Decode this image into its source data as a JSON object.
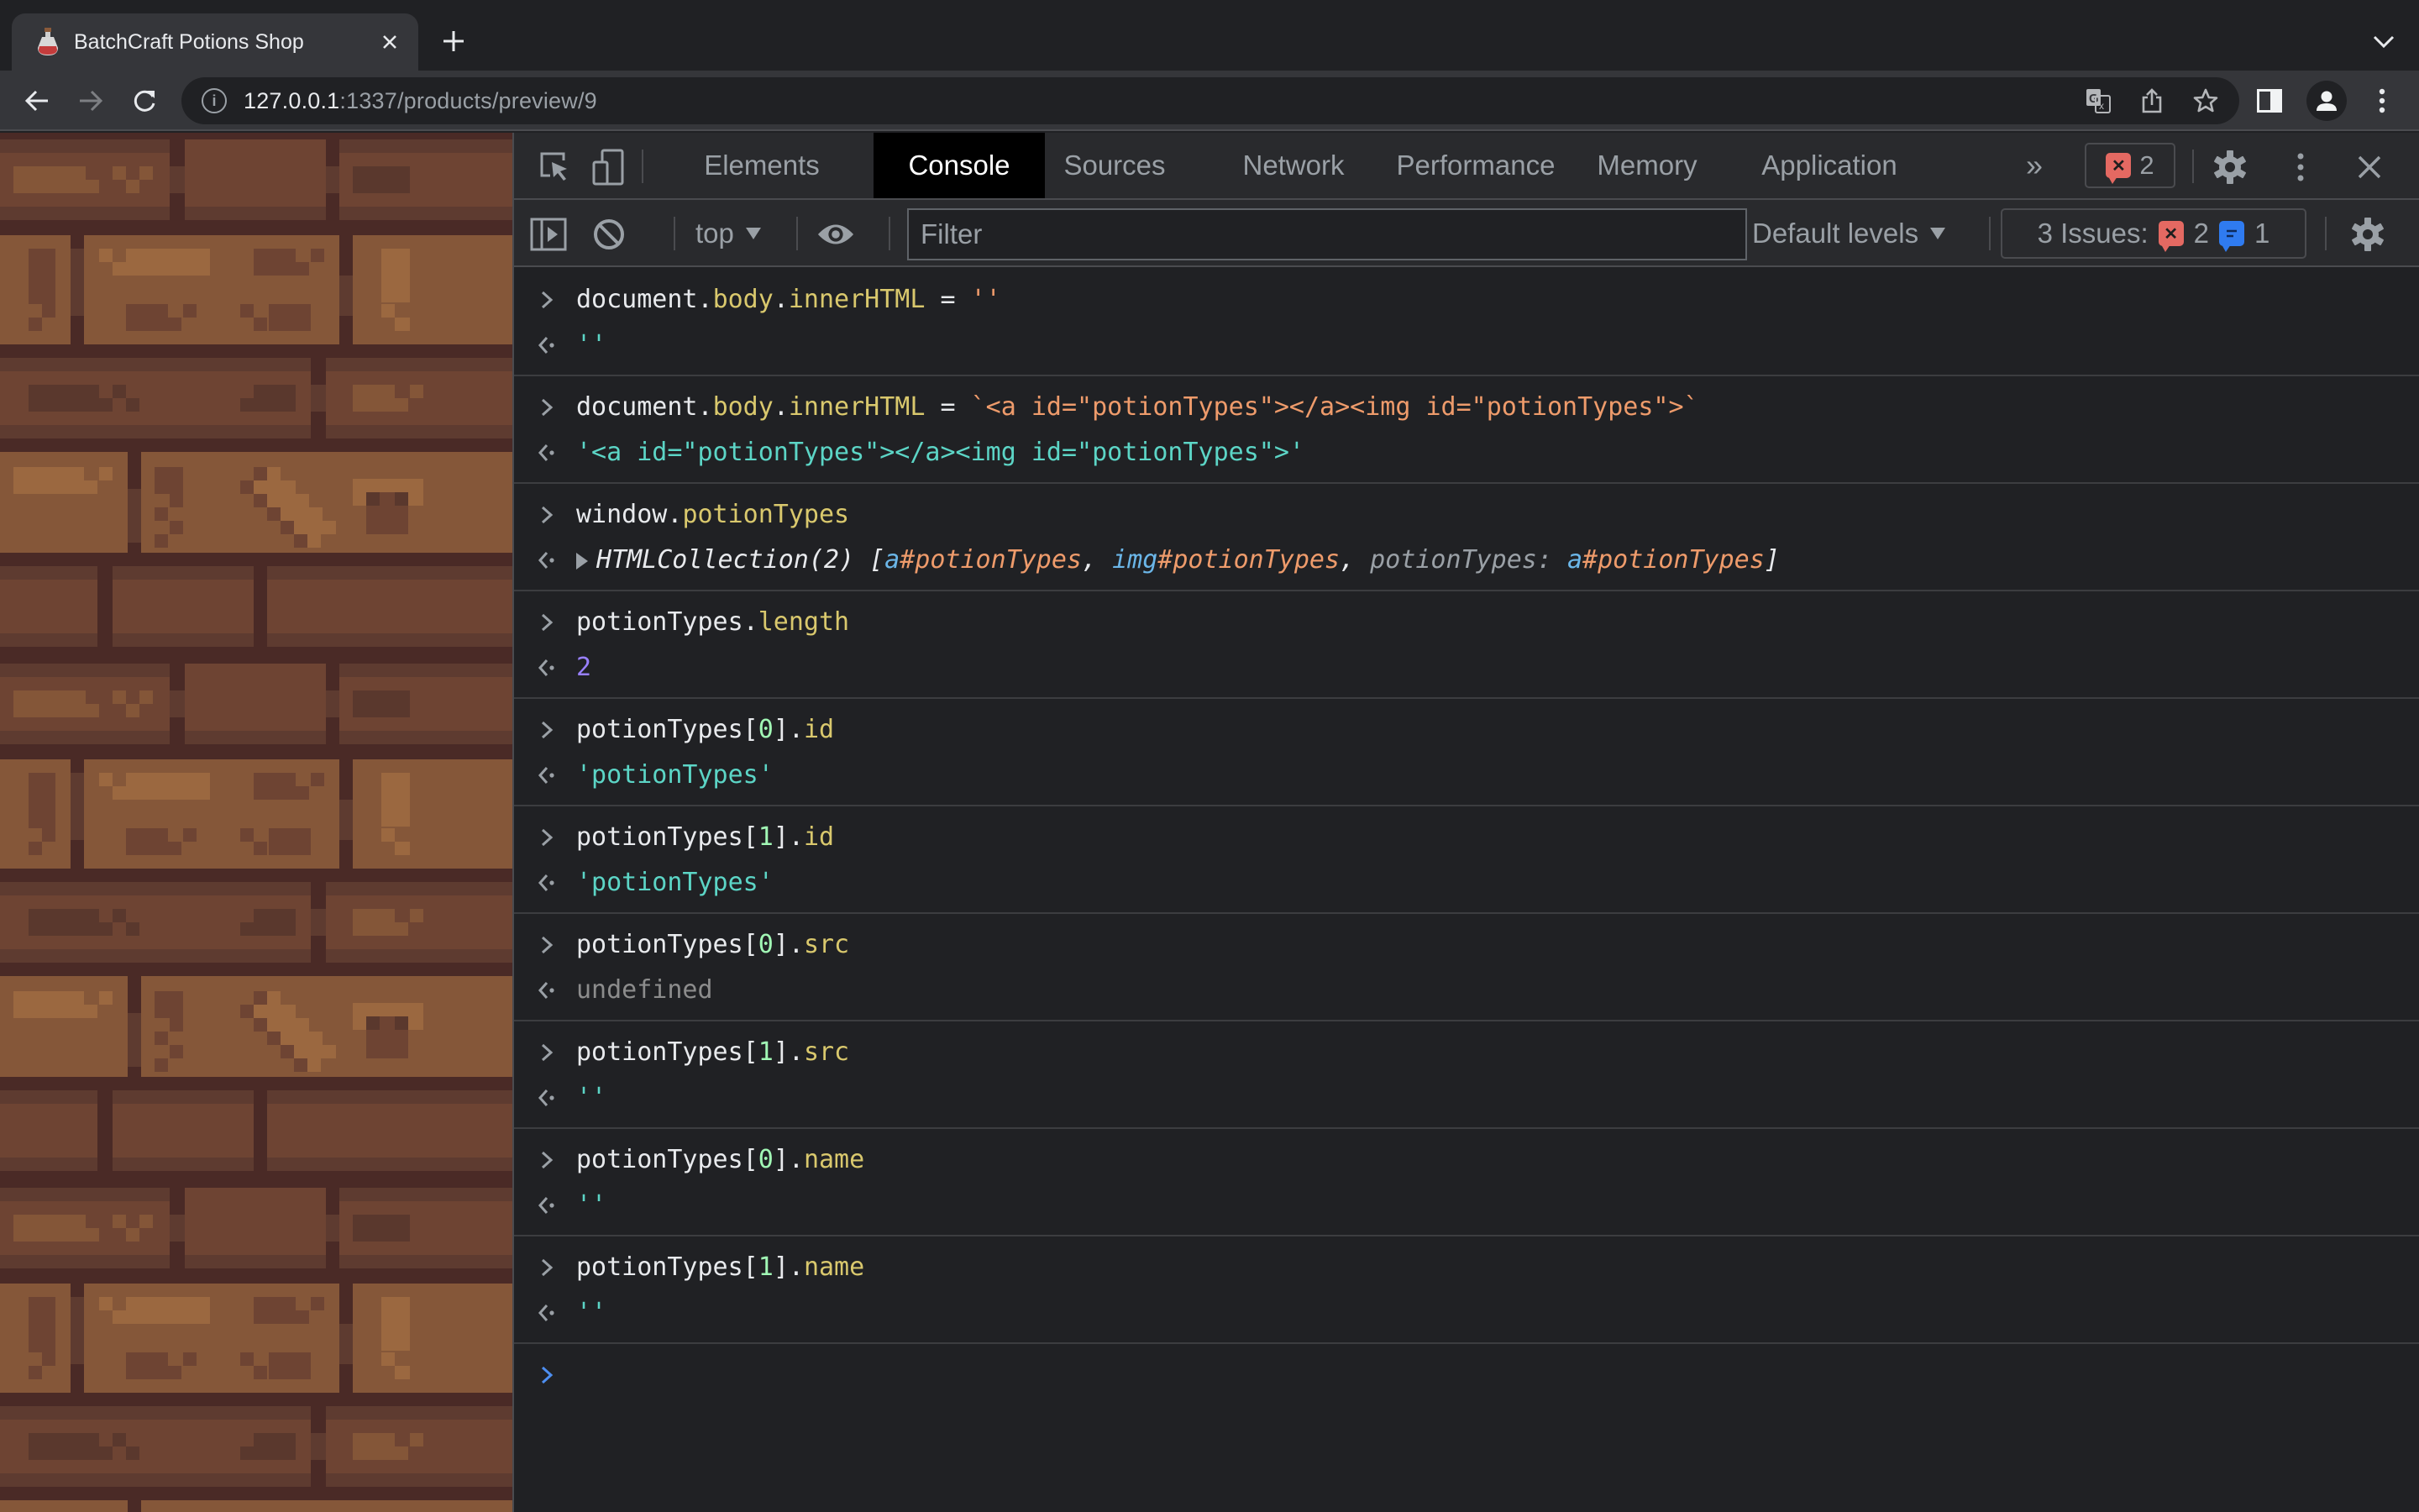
{
  "browser": {
    "tab": {
      "title": "BatchCraft Potions Shop",
      "favicon": "potion-bottle-icon"
    },
    "new_tab_label": "+",
    "url": {
      "host": "127.0.0.1",
      "rest": ":1337/products/preview/9"
    }
  },
  "devtools": {
    "tabs": [
      {
        "label": "Elements",
        "active": false
      },
      {
        "label": "Console",
        "active": true
      },
      {
        "label": "Sources",
        "active": false
      },
      {
        "label": "Network",
        "active": false
      },
      {
        "label": "Performance",
        "active": false
      },
      {
        "label": "Memory",
        "active": false
      },
      {
        "label": "Application",
        "active": false
      }
    ],
    "more_tabs": "»",
    "error_count": "2",
    "toolbar": {
      "context": "top",
      "filter_placeholder": "Filter",
      "levels": "Default levels",
      "issues_label": "3 Issues:",
      "issues_errors": "2",
      "issues_info": "1"
    },
    "colors": {
      "error": "#e46962",
      "info": "#2f7bf0",
      "active_tab_bg": "#000000",
      "console_bg": "#202124"
    }
  },
  "console": {
    "entries": [
      {
        "input": [
          [
            "document",
            "plain"
          ],
          [
            ".",
            "plain"
          ],
          [
            "body",
            "prop"
          ],
          [
            ".",
            "plain"
          ],
          [
            "innerHTML",
            "prop"
          ],
          [
            " = ",
            "plain"
          ],
          [
            "''",
            "str-input"
          ]
        ],
        "output": [
          [
            "''",
            "str"
          ]
        ]
      },
      {
        "input": [
          [
            "document",
            "plain"
          ],
          [
            ".",
            "plain"
          ],
          [
            "body",
            "prop"
          ],
          [
            ".",
            "plain"
          ],
          [
            "innerHTML",
            "prop"
          ],
          [
            " = ",
            "plain"
          ],
          [
            "`<a id=\"potionTypes\"></a><img id=\"potionTypes\">`",
            "str-input"
          ]
        ],
        "output": [
          [
            "'<a id=\"potionTypes\"></a><img id=\"potionTypes\">'",
            "str"
          ]
        ]
      },
      {
        "input": [
          [
            "window",
            "plain"
          ],
          [
            ".",
            "plain"
          ],
          [
            "potionTypes",
            "prop"
          ]
        ],
        "output": [
          [
            "HTMLCollection(2) [",
            "obj"
          ],
          [
            "a",
            "tag"
          ],
          [
            "#potionTypes",
            "id"
          ],
          [
            ", ",
            "obj"
          ],
          [
            "img",
            "tag"
          ],
          [
            "#potionTypes",
            "id"
          ],
          [
            ", ",
            "obj"
          ],
          [
            "potionTypes: ",
            "key"
          ],
          [
            "a",
            "tag"
          ],
          [
            "#potionTypes",
            "id"
          ],
          [
            "]",
            "obj"
          ]
        ],
        "expandable": true
      },
      {
        "input": [
          [
            "potionTypes",
            "plain"
          ],
          [
            ".",
            "plain"
          ],
          [
            "length",
            "prop"
          ]
        ],
        "output": [
          [
            "2",
            "num"
          ]
        ]
      },
      {
        "input": [
          [
            "potionTypes[",
            "plain"
          ],
          [
            "0",
            "num-input"
          ],
          [
            "]",
            "plain"
          ],
          [
            ".",
            "plain"
          ],
          [
            "id",
            "prop"
          ]
        ],
        "output": [
          [
            "'potionTypes'",
            "str"
          ]
        ]
      },
      {
        "input": [
          [
            "potionTypes[",
            "plain"
          ],
          [
            "1",
            "num-input"
          ],
          [
            "]",
            "plain"
          ],
          [
            ".",
            "plain"
          ],
          [
            "id",
            "prop"
          ]
        ],
        "output": [
          [
            "'potionTypes'",
            "str"
          ]
        ]
      },
      {
        "input": [
          [
            "potionTypes[",
            "plain"
          ],
          [
            "0",
            "num-input"
          ],
          [
            "]",
            "plain"
          ],
          [
            ".",
            "plain"
          ],
          [
            "src",
            "prop"
          ]
        ],
        "output": [
          [
            "undefined",
            "undef"
          ]
        ]
      },
      {
        "input": [
          [
            "potionTypes[",
            "plain"
          ],
          [
            "1",
            "num-input"
          ],
          [
            "]",
            "plain"
          ],
          [
            ".",
            "plain"
          ],
          [
            "src",
            "prop"
          ]
        ],
        "output": [
          [
            "''",
            "str"
          ]
        ]
      },
      {
        "input": [
          [
            "potionTypes[",
            "plain"
          ],
          [
            "0",
            "num-input"
          ],
          [
            "]",
            "plain"
          ],
          [
            ".",
            "plain"
          ],
          [
            "name",
            "prop"
          ]
        ],
        "output": [
          [
            "''",
            "str"
          ]
        ]
      },
      {
        "input": [
          [
            "potionTypes[",
            "plain"
          ],
          [
            "1",
            "num-input"
          ],
          [
            "]",
            "plain"
          ],
          [
            ".",
            "plain"
          ],
          [
            "name",
            "prop"
          ]
        ],
        "output": [
          [
            "''",
            "str"
          ]
        ]
      }
    ]
  }
}
